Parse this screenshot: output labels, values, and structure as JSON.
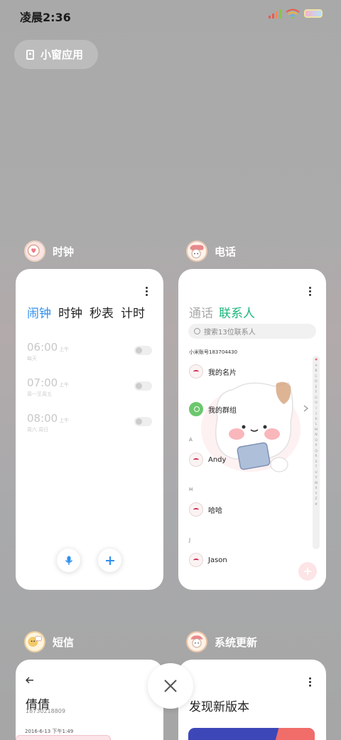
{
  "status_bar": {
    "time": "凌晨2:36",
    "icons": [
      "signal-icon",
      "wifi-icon",
      "battery-icon"
    ]
  },
  "mini_window_button": {
    "label": "小窗应用",
    "icon": "mini-window-icon"
  },
  "apps": {
    "clock": {
      "name": "时钟",
      "tabs": [
        "闹钟",
        "时钟",
        "秒表",
        "计时"
      ],
      "active_tab": 0,
      "alarms": [
        {
          "time": "06:00",
          "ampm": "上午",
          "repeat": "每天",
          "enabled": false
        },
        {
          "time": "07:00",
          "ampm": "上午",
          "repeat": "周一至周五",
          "enabled": false
        },
        {
          "time": "08:00",
          "ampm": "上午",
          "repeat": "周六 周日",
          "enabled": false
        }
      ],
      "accent": "#2f8ff0"
    },
    "phone": {
      "name": "电话",
      "tabs": [
        "通话",
        "联系人"
      ],
      "active_tab": 1,
      "search_placeholder": "搜索13位联系人",
      "account": "小米账号183704430",
      "my_card": "我的名片",
      "my_groups": "我的群组",
      "sections": [
        {
          "letter": "A",
          "contacts": [
            "Andy"
          ]
        },
        {
          "letter": "H",
          "contacts": [
            "哈哈"
          ]
        },
        {
          "letter": "J",
          "contacts": [
            "Jason"
          ]
        }
      ],
      "index_letters": [
        "♥",
        "A",
        "B",
        "C",
        "D",
        "E",
        "F",
        "G",
        "H",
        "I",
        "J",
        "K",
        "L",
        "M",
        "N",
        "O",
        "P",
        "Q",
        "R",
        "S",
        "T",
        "U",
        "V",
        "W",
        "X",
        "Y",
        "Z",
        "#"
      ],
      "accent": "#1db77c"
    },
    "sms": {
      "name": "短信",
      "contact_name": "倩倩",
      "contact_number": "18730218809",
      "timestamp": "2016-6-13 下午1:49"
    },
    "update": {
      "name": "系统更新",
      "headline": "发现新版本"
    }
  },
  "close_button": {
    "icon": "close-icon"
  }
}
